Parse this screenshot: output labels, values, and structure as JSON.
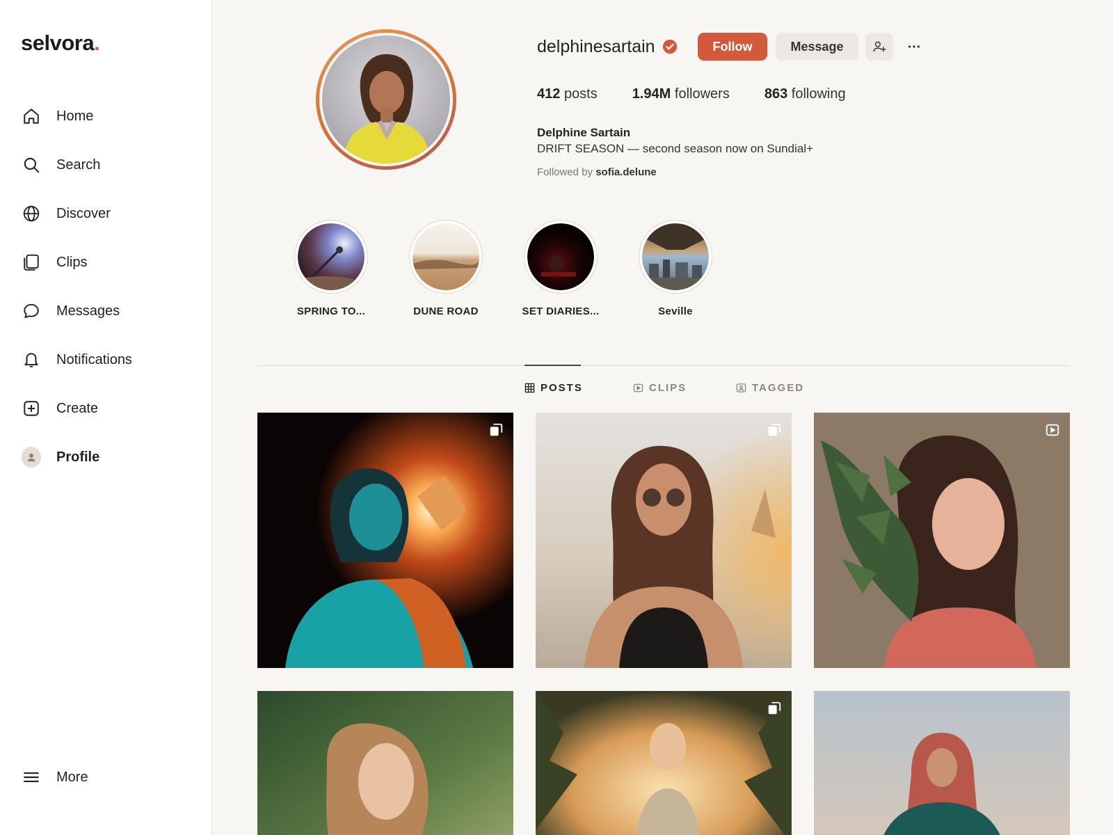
{
  "brand": {
    "name": "selvora",
    "dot": ".",
    "accent": "#d4593b"
  },
  "sidebar": {
    "items": [
      {
        "label": "Home",
        "icon": "home-icon"
      },
      {
        "label": "Search",
        "icon": "search-icon"
      },
      {
        "label": "Discover",
        "icon": "globe-icon"
      },
      {
        "label": "Clips",
        "icon": "clips-icon"
      },
      {
        "label": "Messages",
        "icon": "message-bubble-icon"
      },
      {
        "label": "Notifications",
        "icon": "bell-icon"
      },
      {
        "label": "Create",
        "icon": "plus-square-icon"
      },
      {
        "label": "Profile",
        "icon": "avatar",
        "active": true
      }
    ],
    "more_label": "More"
  },
  "profile": {
    "username": "delphinesartain",
    "verified": true,
    "follow_label": "Follow",
    "message_label": "Message",
    "stats": {
      "posts_value": "412",
      "posts_label": "posts",
      "followers_value": "1.94M",
      "followers_label": "followers",
      "following_value": "863",
      "following_label": "following"
    },
    "display_name": "Delphine Sartain",
    "bio": "DRIFT SEASON — second season now on Sundial+",
    "followed_by_prefix": "Followed by",
    "followed_by_user": "sofia.delune"
  },
  "highlights": [
    {
      "label": "SPRING TO..."
    },
    {
      "label": "DUNE ROAD"
    },
    {
      "label": "SET DIARIES..."
    },
    {
      "label": "Seville"
    }
  ],
  "tabs": [
    {
      "label": "POSTS",
      "icon": "grid-icon",
      "active": true
    },
    {
      "label": "CLIPS",
      "icon": "clip-play-icon"
    },
    {
      "label": "TAGGED",
      "icon": "tag-person-icon"
    }
  ],
  "posts": [
    {
      "type": "carousel",
      "corner_icon": "carousel-icon"
    },
    {
      "type": "carousel",
      "corner_icon": "carousel-icon"
    },
    {
      "type": "clip",
      "corner_icon": "clip-play-icon"
    },
    {
      "type": "photo"
    },
    {
      "type": "carousel",
      "corner_icon": "carousel-icon"
    },
    {
      "type": "photo"
    }
  ]
}
